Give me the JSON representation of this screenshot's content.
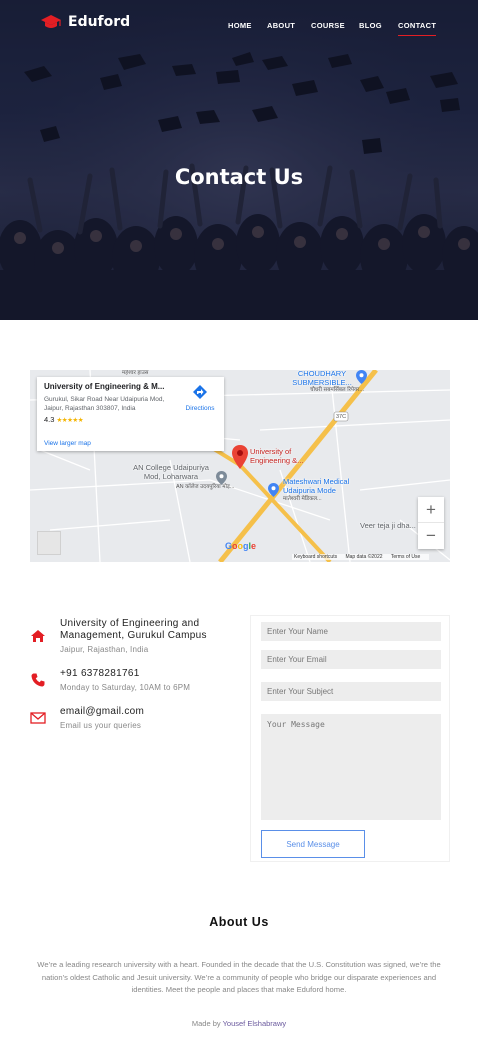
{
  "brand": {
    "name": "Eduford",
    "accent": "#e31e24"
  },
  "nav": {
    "items": [
      {
        "label": "HOME"
      },
      {
        "label": "ABOUT"
      },
      {
        "label": "COURSE"
      },
      {
        "label": "BLOG"
      },
      {
        "label": "CONTACT"
      }
    ],
    "active": "CONTACT"
  },
  "hero": {
    "title": "Contact Us"
  },
  "map": {
    "card": {
      "title": "University of Engineering & M...",
      "address": "Gurukul, Sikar Road Near Udaipuria Mod, Jaipur, Rajasthan 303807, India",
      "rating": "4.3",
      "stars": "★★★★★",
      "directions": "Directions",
      "larger_map": "View larger map"
    },
    "labels": {
      "pin": "University of Engineering &...",
      "choudhary": "CHOUDHARY SUBMERSIBLE...",
      "choudhary_hi": "चौधरी सबमर्सिबल रिपेयर...",
      "college": "AN College Udaipuriya Mod, Loharwara",
      "college_hi": "AN कॉलेज उदयपुरिया मोड़...",
      "medical": "Mateshwari Medical Udaipuria Mode",
      "medical_hi": "मातेश्वरी मेडिकल...",
      "veer": "Veer teja ji dha...",
      "road": "37C",
      "top": "महेश्वर हाउस"
    },
    "google": "Google",
    "footer": {
      "shortcuts": "Keyboard shortcuts",
      "data": "Map data ©2022",
      "terms": "Terms of Use"
    }
  },
  "contact": {
    "address": {
      "main": "University of Engineering and Management, Gurukul Campus",
      "sub": "Jaipur, Rajasthan, India",
      "icon": "home-icon"
    },
    "phone": {
      "main": "+91 6378281761",
      "sub": "Monday to Saturday, 10AM to 6PM",
      "icon": "phone-icon"
    },
    "email": {
      "main": "email@gmail.com",
      "sub": "Email us your queries",
      "icon": "mail-icon"
    }
  },
  "form": {
    "name_placeholder": "Enter Your Name",
    "email_placeholder": "Enter Your Email",
    "subject_placeholder": "Enter Your Subject",
    "message_placeholder": "Your Message",
    "submit_label": "Send Message",
    "button_color": "#5a8fe8"
  },
  "about": {
    "title": "About Us",
    "text": "We’re a leading research university with a heart. Founded in the decade that the U.S. Constitution was signed, we’re the nation’s oldest Catholic and Jesuit university. We’re a community of people who bridge our disparate experiences and identities. Meet the people and places that make Eduford home."
  },
  "footer": {
    "prefix": "Made by",
    "author": "Yousef Elshabrawy"
  }
}
